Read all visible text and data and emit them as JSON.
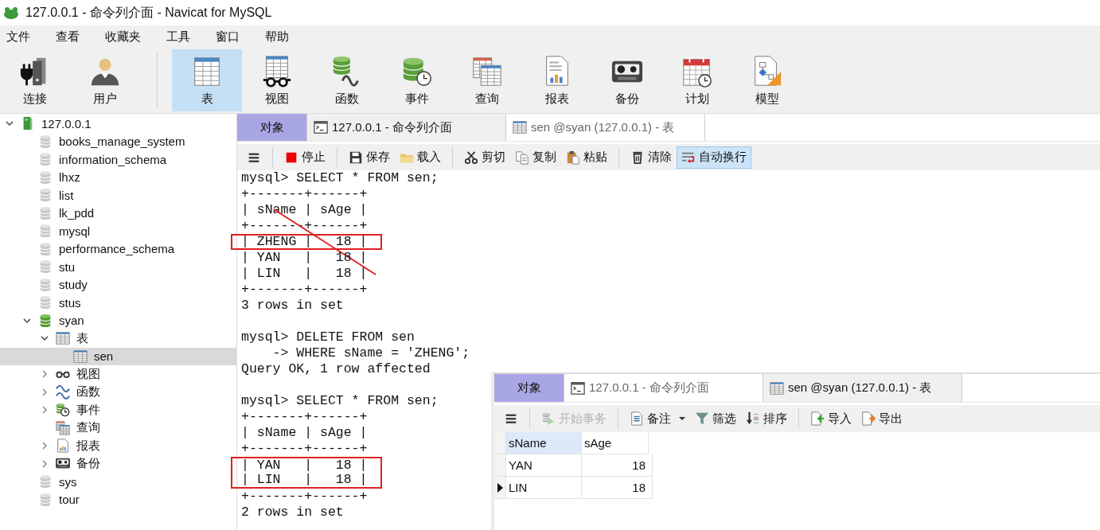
{
  "window": {
    "title": "127.0.0.1 - 命令列介面 - Navicat for MySQL"
  },
  "menu": [
    "文件",
    "查看",
    "收藏夹",
    "工具",
    "窗口",
    "帮助"
  ],
  "connection_tools": [
    {
      "label": "连接",
      "kind": "connect",
      "selected": false
    },
    {
      "label": "用户",
      "kind": "user",
      "selected": false
    }
  ],
  "object_tools": [
    {
      "label": "表",
      "kind": "table",
      "selected": true
    },
    {
      "label": "视图",
      "kind": "view",
      "selected": false
    },
    {
      "label": "函数",
      "kind": "function",
      "selected": false
    },
    {
      "label": "事件",
      "kind": "event",
      "selected": false
    },
    {
      "label": "查询",
      "kind": "query",
      "selected": false
    },
    {
      "label": "报表",
      "kind": "report",
      "selected": false
    },
    {
      "label": "备份",
      "kind": "backup",
      "selected": false
    },
    {
      "label": "计划",
      "kind": "schedule",
      "selected": false
    },
    {
      "label": "模型",
      "kind": "model",
      "selected": false
    }
  ],
  "sidebar": {
    "tree": [
      {
        "label": "127.0.0.1",
        "kind": "server",
        "expanded": true,
        "selected": false,
        "children": [
          {
            "label": "books_manage_system",
            "kind": "database",
            "active": false,
            "selected": false
          },
          {
            "label": "information_schema",
            "kind": "database",
            "active": false,
            "selected": false
          },
          {
            "label": "lhxz",
            "kind": "database",
            "active": false,
            "selected": false
          },
          {
            "label": "list",
            "kind": "database",
            "active": false,
            "selected": false
          },
          {
            "label": "lk_pdd",
            "kind": "database",
            "active": false,
            "selected": false
          },
          {
            "label": "mysql",
            "kind": "database",
            "active": false,
            "selected": false
          },
          {
            "label": "performance_schema",
            "kind": "database",
            "active": false,
            "selected": false
          },
          {
            "label": "stu",
            "kind": "database",
            "active": false,
            "selected": false
          },
          {
            "label": "study",
            "kind": "database",
            "active": false,
            "selected": false
          },
          {
            "label": "stus",
            "kind": "database",
            "active": false,
            "selected": false
          },
          {
            "label": "syan",
            "kind": "database",
            "active": true,
            "expanded": true,
            "selected": false,
            "children": [
              {
                "label": "表",
                "kind": "tables",
                "expanded": true,
                "selected": false,
                "children": [
                  {
                    "label": "sen",
                    "kind": "table",
                    "selected": true
                  }
                ]
              },
              {
                "label": "视图",
                "kind": "views",
                "expanded": false,
                "selected": false
              },
              {
                "label": "函数",
                "kind": "functions",
                "expanded": false,
                "selected": false
              },
              {
                "label": "事件",
                "kind": "events",
                "expanded": false,
                "selected": false
              },
              {
                "label": "查询",
                "kind": "queries",
                "selected": false
              },
              {
                "label": "报表",
                "kind": "reports",
                "expanded": false,
                "selected": false
              },
              {
                "label": "备份",
                "kind": "backups",
                "expanded": false,
                "selected": false
              }
            ]
          },
          {
            "label": "sys",
            "kind": "database",
            "active": false,
            "selected": false
          },
          {
            "label": "tour",
            "kind": "database",
            "active": false,
            "selected": false
          }
        ]
      }
    ]
  },
  "workspace": {
    "tabs": [
      {
        "label": "对象",
        "kind": "objects",
        "selected": false
      },
      {
        "label": "127.0.0.1 - 命令列介面",
        "kind": "console",
        "selected": true
      },
      {
        "label": "sen @syan (127.0.0.1) - 表",
        "kind": "table",
        "selected": false
      }
    ],
    "toolbar": [
      [
        {
          "kind": "menu",
          "on": false
        }
      ],
      [
        {
          "label": "停止",
          "kind": "stop",
          "on": false
        }
      ],
      [
        {
          "label": "保存",
          "kind": "save",
          "on": false
        },
        {
          "label": "载入",
          "kind": "load",
          "on": false
        }
      ],
      [
        {
          "label": "剪切",
          "kind": "cut",
          "on": false
        },
        {
          "label": "复制",
          "kind": "copy",
          "on": false
        },
        {
          "label": "粘贴",
          "kind": "paste",
          "on": false
        }
      ],
      [
        {
          "label": "清除",
          "kind": "clear",
          "on": false
        },
        {
          "label": "自动换行",
          "kind": "wrap",
          "on": true
        }
      ]
    ],
    "console": {
      "blocks": [
        {
          "lines": [
            {
              "text": "mysql> SELECT * FROM sen;",
              "boxed": false,
              "struck": false
            },
            {
              "text": "+-------+------+",
              "boxed": false,
              "struck": false
            },
            {
              "text": "| sName | sAge |",
              "boxed": false,
              "struck": false
            },
            {
              "text": "+-------+------+",
              "boxed": false,
              "struck": false
            },
            {
              "text": "| ZHENG |   18 |",
              "boxed": true,
              "struck": true
            },
            {
              "text": "| YAN   |   18 |",
              "boxed": false,
              "struck": false
            },
            {
              "text": "| LIN   |   18 |",
              "boxed": false,
              "struck": false
            },
            {
              "text": "+-------+------+",
              "boxed": false,
              "struck": false
            },
            {
              "text": "3 rows in set",
              "boxed": false,
              "struck": false
            }
          ]
        },
        {
          "lines": [
            {
              "text": "mysql> DELETE FROM sen",
              "boxed": false,
              "struck": false
            },
            {
              "text": "    -> WHERE sName = 'ZHENG';",
              "boxed": false,
              "struck": false
            },
            {
              "text": "Query OK, 1 row affected",
              "boxed": false,
              "struck": false
            }
          ]
        },
        {
          "lines": [
            {
              "text": "mysql> SELECT * FROM sen;",
              "boxed": false,
              "struck": false
            },
            {
              "text": "+-------+------+",
              "boxed": false,
              "struck": false
            },
            {
              "text": "| sName | sAge |",
              "boxed": false,
              "struck": false
            },
            {
              "text": "+-------+------+",
              "boxed": false,
              "struck": false
            },
            {
              "text": "| YAN   |   18 |",
              "boxed": true,
              "struck": false
            },
            {
              "text": "| LIN   |   18 |",
              "boxed": true,
              "struck": false
            },
            {
              "text": "+-------+------+",
              "boxed": false,
              "struck": false
            },
            {
              "text": "2 rows in set",
              "boxed": false,
              "struck": false
            }
          ]
        }
      ]
    }
  },
  "overlay_window": {
    "tabs": [
      {
        "label": "对象",
        "kind": "objects",
        "selected": false
      },
      {
        "label": "127.0.0.1 - 命令列介面",
        "kind": "console",
        "selected": false
      },
      {
        "label": "sen @syan (127.0.0.1) - 表",
        "kind": "table",
        "selected": true
      }
    ],
    "toolbar": [
      [
        {
          "kind": "menu",
          "disabled": false,
          "dropdown": false
        }
      ],
      [
        {
          "label": "开始事务",
          "kind": "transaction",
          "disabled": true,
          "dropdown": false
        }
      ],
      [
        {
          "label": "备注",
          "kind": "notes",
          "disabled": false,
          "dropdown": true
        },
        {
          "label": "筛选",
          "kind": "filter",
          "disabled": false,
          "dropdown": false
        },
        {
          "label": "排序",
          "kind": "sort",
          "disabled": false,
          "dropdown": false
        }
      ],
      [
        {
          "label": "导入",
          "kind": "import",
          "disabled": false,
          "dropdown": false
        },
        {
          "label": "导出",
          "kind": "export",
          "disabled": false,
          "dropdown": false
        }
      ]
    ],
    "grid": {
      "columns": [
        {
          "label": "sName",
          "selected": true
        },
        {
          "label": "sAge",
          "selected": false
        }
      ],
      "rows": [
        {
          "cells": [
            "YAN",
            "18"
          ],
          "current": false
        },
        {
          "cells": [
            "LIN",
            "18"
          ],
          "current": true
        }
      ]
    }
  }
}
